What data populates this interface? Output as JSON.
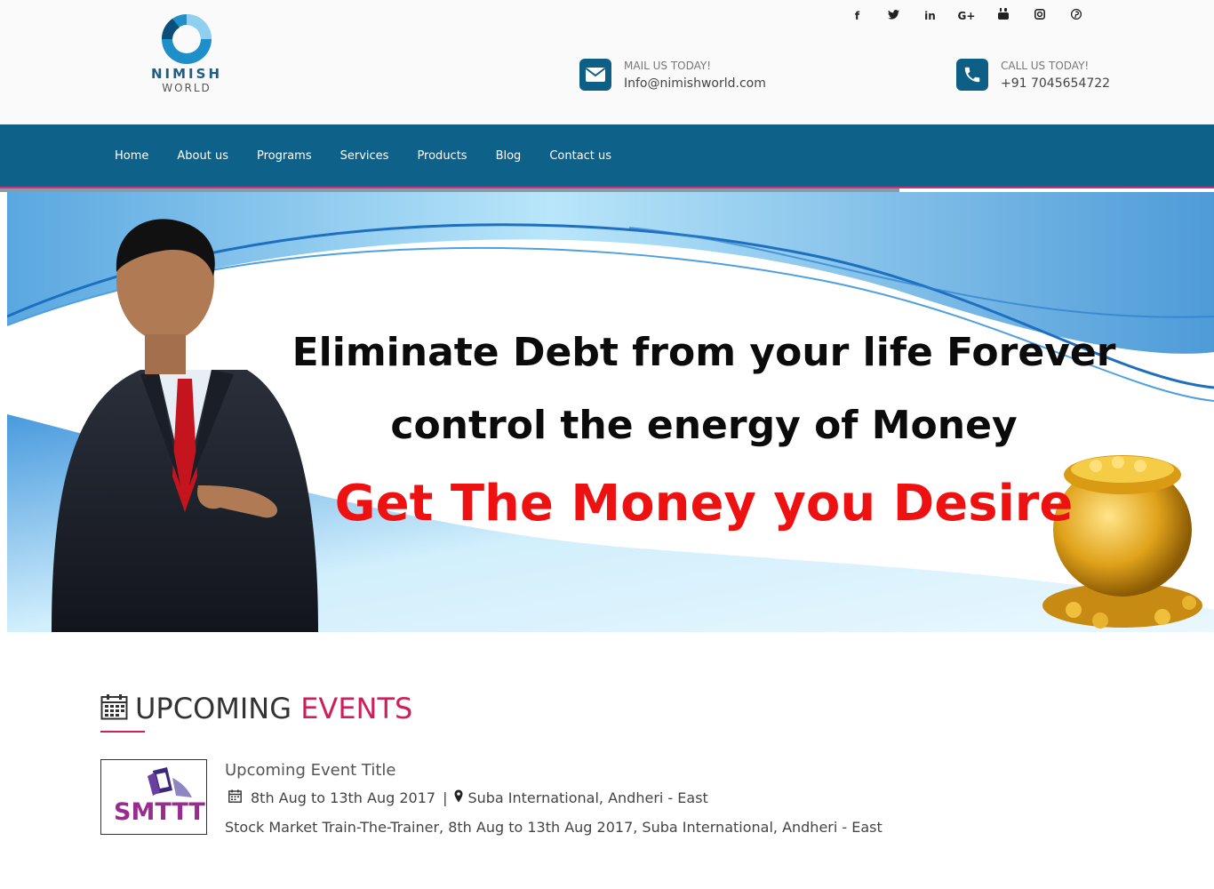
{
  "brand": {
    "name": "NIMISH",
    "sub": "WORLD",
    "primary_color": "#0e6188",
    "accent_color": "#d01e5a"
  },
  "social": [
    "f",
    "t",
    "in",
    "G+",
    "yt",
    "ig",
    "p"
  ],
  "contact": {
    "mail_label": "MAIL US TODAY!",
    "mail_value": "Info@nimishworld.com",
    "call_label": "CALL US TODAY!",
    "call_value": "+91 7045654722"
  },
  "nav": {
    "items": [
      "Home",
      "About us",
      "Programs",
      "Services",
      "Products",
      "Blog",
      "Contact us"
    ]
  },
  "banner": {
    "line1": "Eliminate Debt from your life Forever",
    "line2": "control the energy of Money",
    "line3": "Get The Money you Desire"
  },
  "events": {
    "title_main": "UPCOMING",
    "title_accent": "EVENTS",
    "items": [
      {
        "thumb_text": "SMTTT",
        "title": "Upcoming Event Title",
        "dates": "8th Aug to 13th Aug 2017",
        "sep": "|",
        "venue": "Suba International, Andheri - East",
        "description": "Stock Market Train-The-Trainer, 8th Aug to 13th Aug 2017, Suba International, Andheri - East"
      }
    ]
  }
}
